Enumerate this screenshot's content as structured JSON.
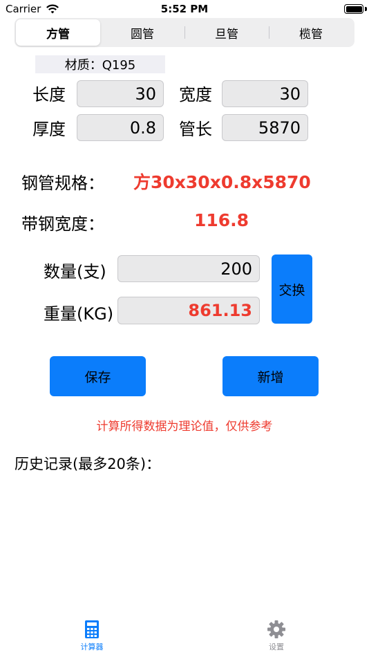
{
  "status_bar": {
    "carrier": "Carrier",
    "time": "5:52 PM"
  },
  "tabs_top": [
    {
      "label": "方管",
      "selected": true
    },
    {
      "label": "圆管",
      "selected": false
    },
    {
      "label": "旦管",
      "selected": false
    },
    {
      "label": "榄管",
      "selected": false
    }
  ],
  "material": "材质：Q195",
  "dims": {
    "length_label": "长度",
    "length_value": "30",
    "width_label": "宽度",
    "width_value": "30",
    "thickness_label": "厚度",
    "thickness_value": "0.8",
    "pipe_length_label": "管长",
    "pipe_length_value": "5870"
  },
  "results": {
    "spec_label": "钢管规格：",
    "spec_value": "方30x30x0.8x5870",
    "strip_label": "带钢宽度：",
    "strip_value": "116.8"
  },
  "quantity": {
    "label": "数量(支)",
    "value": "200"
  },
  "weight": {
    "label": "重量(KG)",
    "value": "861.13"
  },
  "buttons": {
    "swap": "交换",
    "save": "保存",
    "add": "新增"
  },
  "notice": "计算所得数据为理论值，仅供参考",
  "history_label": "历史记录(最多20条)：",
  "tabbar": [
    {
      "label": "计算器",
      "icon": "calculator-icon",
      "active": true
    },
    {
      "label": "设置",
      "icon": "gear-icon",
      "active": false
    }
  ],
  "colors": {
    "accent": "#0b7dfb",
    "highlight": "#ee3b2f",
    "field_bg": "#e9e9ea"
  }
}
